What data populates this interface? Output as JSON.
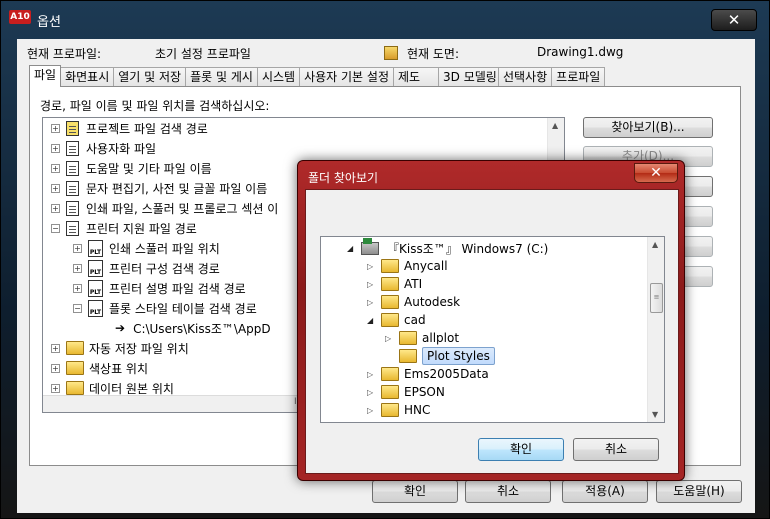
{
  "window": {
    "app_icon": "A10",
    "title": "옵션",
    "close_glyph": "✕"
  },
  "profile": {
    "current_profile_label": "현재 프로파일:",
    "current_profile_value": "초기 설정 프로파일",
    "current_drawing_label": "현재 도면:",
    "current_drawing_value": "Drawing1.dwg"
  },
  "tabs": [
    {
      "label": "파일",
      "active": true
    },
    {
      "label": "화면표시"
    },
    {
      "label": "열기 및 저장"
    },
    {
      "label": "플롯 및 게시"
    },
    {
      "label": "시스템"
    },
    {
      "label": "사용자 기본 설정"
    },
    {
      "label": "제도"
    },
    {
      "label": "3D 모델링"
    },
    {
      "label": "선택사항"
    },
    {
      "label": "프로파일"
    }
  ],
  "files_tab": {
    "instruction": "경로, 파일 이름 및 파일 위치를 검색하십시오:",
    "tree": [
      {
        "label": "프로젝트 파일 검색 경로",
        "icon": "project-file-icon"
      },
      {
        "label": "사용자화 파일",
        "icon": "file-icon"
      },
      {
        "label": "도움말 및 기타 파일 이름",
        "icon": "file-icon"
      },
      {
        "label": "문자 편집기, 사전 및 글꼴 파일 이름",
        "icon": "file-icon"
      },
      {
        "label": "인쇄 파일, 스풀러 및 프롤로그 섹션 이",
        "icon": "file-icon"
      },
      {
        "label": "프린터 지원 파일 경로",
        "icon": "printer-support-icon"
      },
      {
        "label": "인쇄 스풀러 파일 위치",
        "icon": "plt-icon"
      },
      {
        "label": "프린터 구성 검색 경로",
        "icon": "plt-icon"
      },
      {
        "label": "프린터 설명 파일 검색 경로",
        "icon": "plt-icon"
      },
      {
        "label": "플롯 스타일 테이블 검색 경로",
        "icon": "plt-icon"
      },
      {
        "label": "C:\\Users\\Kiss조™\\AppD",
        "icon": "arrow-icon"
      },
      {
        "label": "자동 저장 파일 위치",
        "icon": "folder-icon"
      },
      {
        "label": "색상표 위치",
        "icon": "folder-icon"
      },
      {
        "label": "데이터 원본 위치",
        "icon": "folder-icon"
      }
    ],
    "browse_button": "찾아보기(B)...",
    "add_button": "추가(D)...",
    "hscroll_grip": "III"
  },
  "bottom_buttons": {
    "ok": "확인",
    "cancel": "취소",
    "apply": "적용(A)",
    "help": "도움말(H)"
  },
  "browse_dialog": {
    "title": "폴더 찾아보기",
    "close_glyph": "✕",
    "drive": "『Kiss조™』 Windows7 (C:)",
    "folders": [
      {
        "label": "Anycall"
      },
      {
        "label": "ATI"
      },
      {
        "label": "Autodesk"
      },
      {
        "label": "cad",
        "expanded": true
      },
      {
        "label": "allplot"
      },
      {
        "label": "Plot Styles",
        "selected": true
      },
      {
        "label": "Ems2005Data"
      },
      {
        "label": "EPSON"
      },
      {
        "label": "HNC"
      }
    ],
    "ok": "확인",
    "cancel": "취소"
  }
}
